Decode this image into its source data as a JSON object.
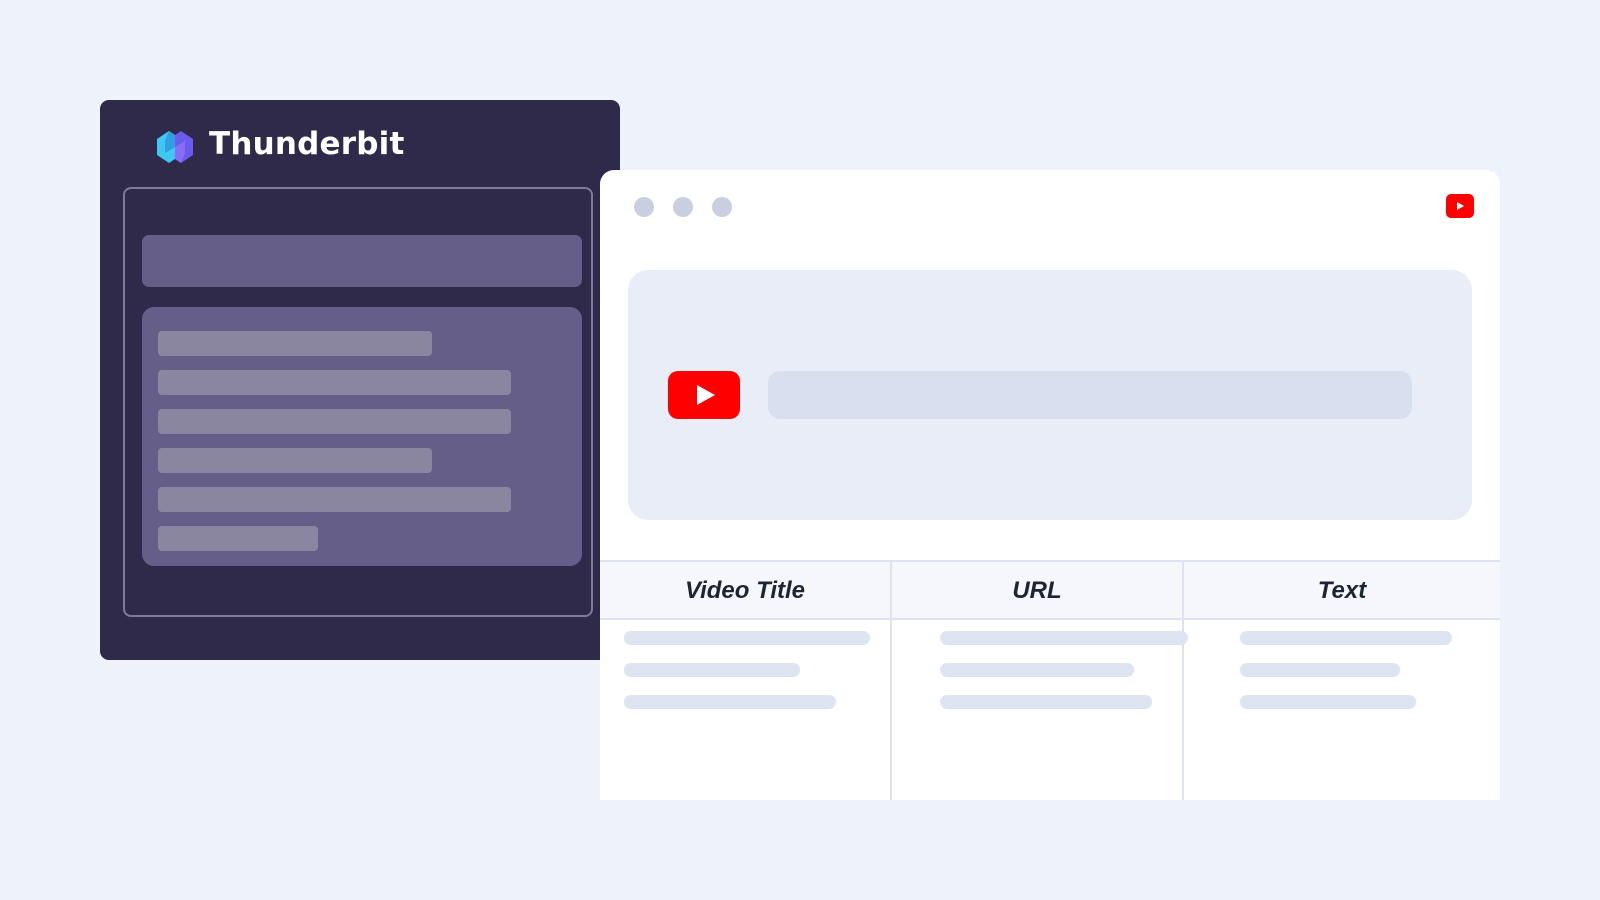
{
  "extension": {
    "brand_name": "Thunderbit",
    "logo_icon": "thunderbit-logo-icon",
    "colors": {
      "panel_bg": "#2f2a4a",
      "accent_cyan": "#3ec7f2",
      "accent_violet": "#6b5bf0"
    }
  },
  "browser": {
    "window_dots": 3,
    "site_icon": "youtube-icon",
    "colors": {
      "youtube_red": "#ff0000"
    }
  },
  "video": {
    "play_icon": "youtube-play-icon"
  },
  "table": {
    "columns": [
      {
        "label": "Video Title"
      },
      {
        "label": "URL"
      },
      {
        "label": "Text"
      }
    ]
  }
}
